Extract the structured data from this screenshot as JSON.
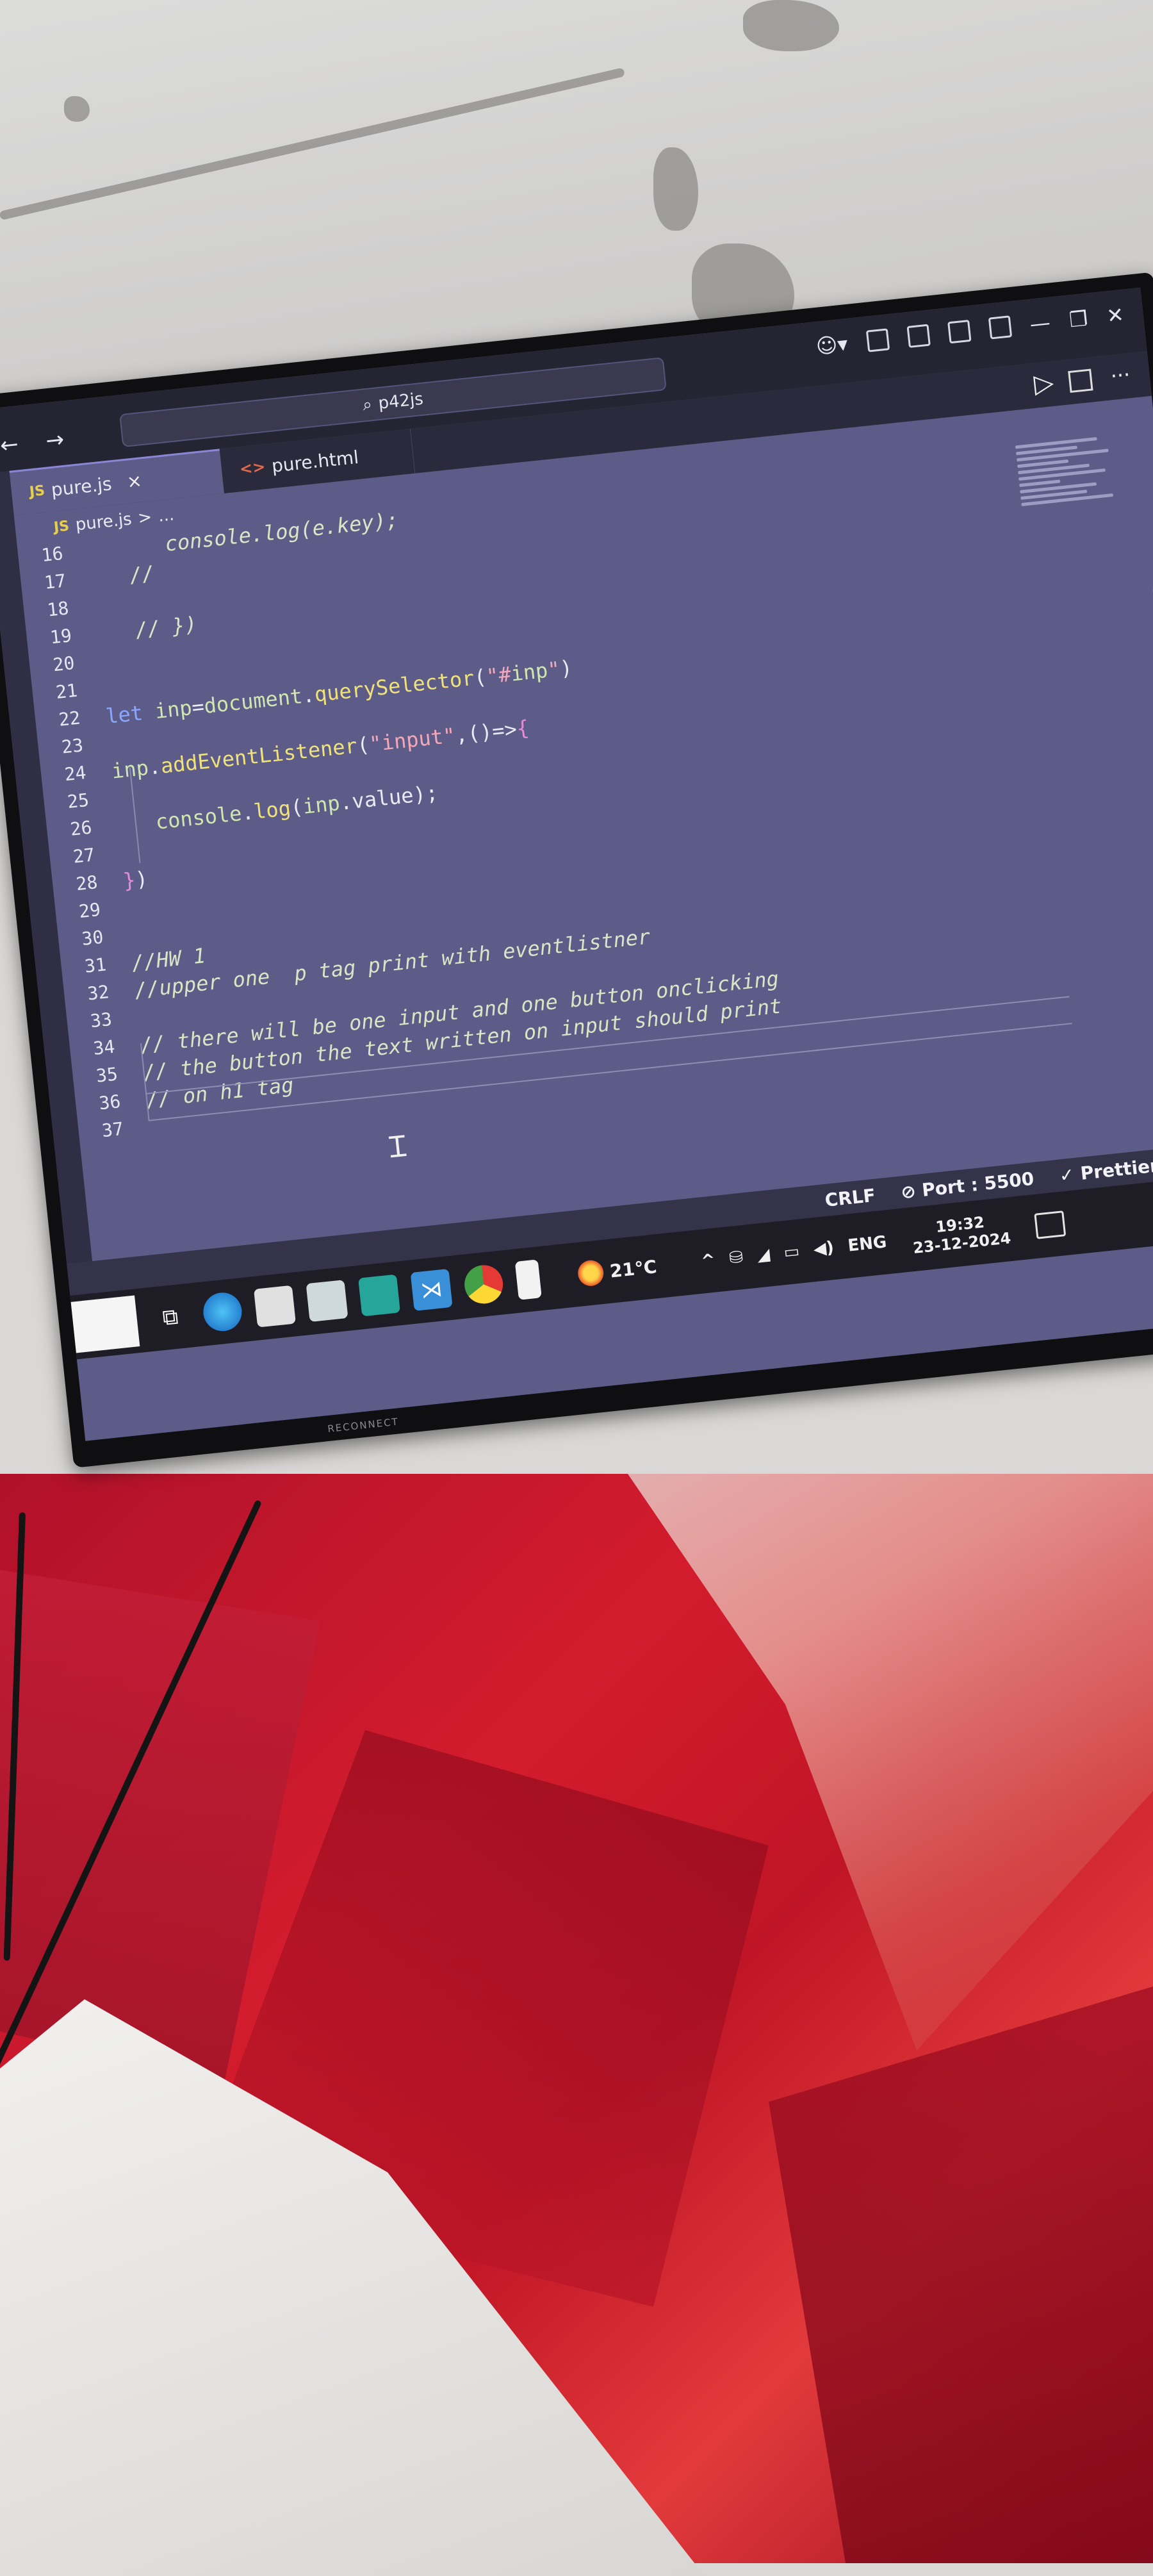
{
  "window": {
    "search_text": "p42js",
    "back_arrow": "←",
    "forward_arrow": "→"
  },
  "tabs": [
    {
      "label": "pure.js",
      "badge": "JS",
      "active": true,
      "close": "×"
    },
    {
      "label": "pure.html",
      "badge": "<>",
      "active": false
    }
  ],
  "breadcrumb": {
    "badge": "JS",
    "file": "pure.js",
    "sep": ">",
    "rest": "..."
  },
  "code_lines": [
    {
      "n": "16",
      "text": "console.log(e.key);",
      "kind": "comment-code",
      "indent": 2
    },
    {
      "n": "17",
      "text": "//",
      "kind": "comment",
      "indent": 1
    },
    {
      "n": "18",
      "text": "",
      "kind": "plain",
      "indent": 0
    },
    {
      "n": "19",
      "text": "// })",
      "kind": "comment",
      "indent": 1
    },
    {
      "n": "20",
      "text": "",
      "kind": "plain",
      "indent": 0
    },
    {
      "n": "21",
      "text": "",
      "kind": "plain",
      "indent": 0
    },
    {
      "n": "22",
      "text": "let inp=document.querySelector(\"#inp\")",
      "kind": "let",
      "indent": 0
    },
    {
      "n": "23",
      "text": "",
      "kind": "plain",
      "indent": 0
    },
    {
      "n": "24",
      "text": "inp.addEventListener(\"input\",()=>{",
      "kind": "listener",
      "indent": 0
    },
    {
      "n": "25",
      "text": "",
      "kind": "plain",
      "indent": 0
    },
    {
      "n": "26",
      "text": "console.log(inp.value);",
      "kind": "log",
      "indent": 1
    },
    {
      "n": "27",
      "text": "",
      "kind": "plain",
      "indent": 0
    },
    {
      "n": "28",
      "text": "})",
      "kind": "close",
      "indent": 0
    },
    {
      "n": "29",
      "text": "",
      "kind": "plain",
      "indent": 0
    },
    {
      "n": "30",
      "text": "",
      "kind": "plain",
      "indent": 0
    },
    {
      "n": "31",
      "text": "//HW 1",
      "kind": "comment",
      "indent": 0
    },
    {
      "n": "32",
      "text": "//upper one  p tag print with eventlistner",
      "kind": "comment",
      "indent": 0
    },
    {
      "n": "33",
      "text": "",
      "kind": "plain",
      "indent": 0
    },
    {
      "n": "34",
      "text": "// there will be one input and one button onclicking",
      "kind": "comment",
      "indent": 0
    },
    {
      "n": "35",
      "text": "// the button the text written on input should print",
      "kind": "comment",
      "indent": 0
    },
    {
      "n": "36",
      "text": "// on h1 tag",
      "kind": "comment",
      "indent": 0
    },
    {
      "n": "37",
      "text": "",
      "kind": "plain",
      "indent": 0
    }
  ],
  "statusbar": {
    "eol": "CRLF",
    "port": "Port : 5500",
    "prettier": "Prettier",
    "port_icon": "⊘",
    "prettier_icon": "✓"
  },
  "taskbar": {
    "temperature": "21°C",
    "language": "ENG",
    "time": "19:32",
    "date": "23-12-2024"
  },
  "monitor": {
    "brand": "RECONNECT"
  },
  "colors": {
    "editor_bg": "#5d5c88",
    "keyword": "#8aa7ff",
    "string": "#f4a7b8",
    "function": "#f0e27a",
    "backdrop_red": "#c8182c"
  }
}
